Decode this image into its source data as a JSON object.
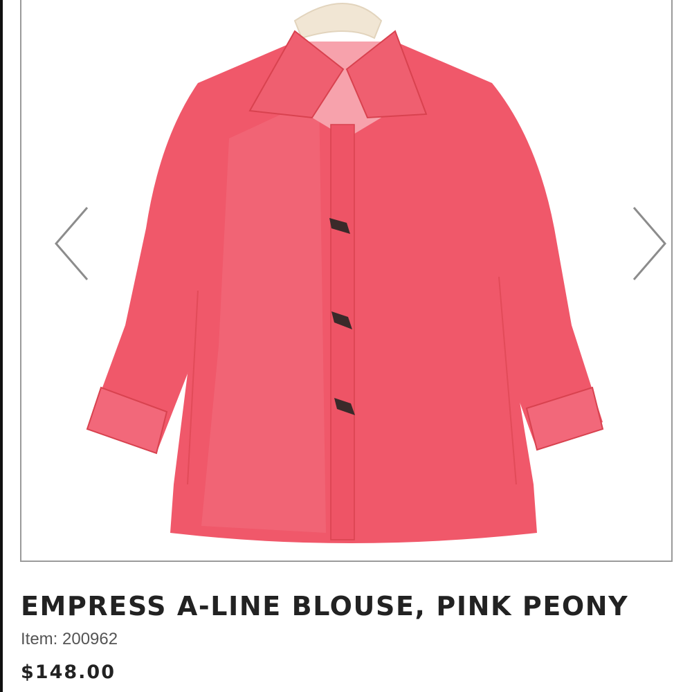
{
  "product": {
    "title": "EMPRESS A-LINE BLOUSE, PINK PEONY",
    "item_number": "Item: 200962",
    "price": "$148.00",
    "image_colors": {
      "blouse": "#f0586a",
      "blouse_highlight": "#f47a89",
      "blouse_shadow": "#d8424f",
      "hanger": "#f1e6d4",
      "toggles": "#3a2a2a"
    }
  },
  "carousel": {
    "prev_icon": "chevron-left-icon",
    "next_icon": "chevron-right-icon"
  }
}
